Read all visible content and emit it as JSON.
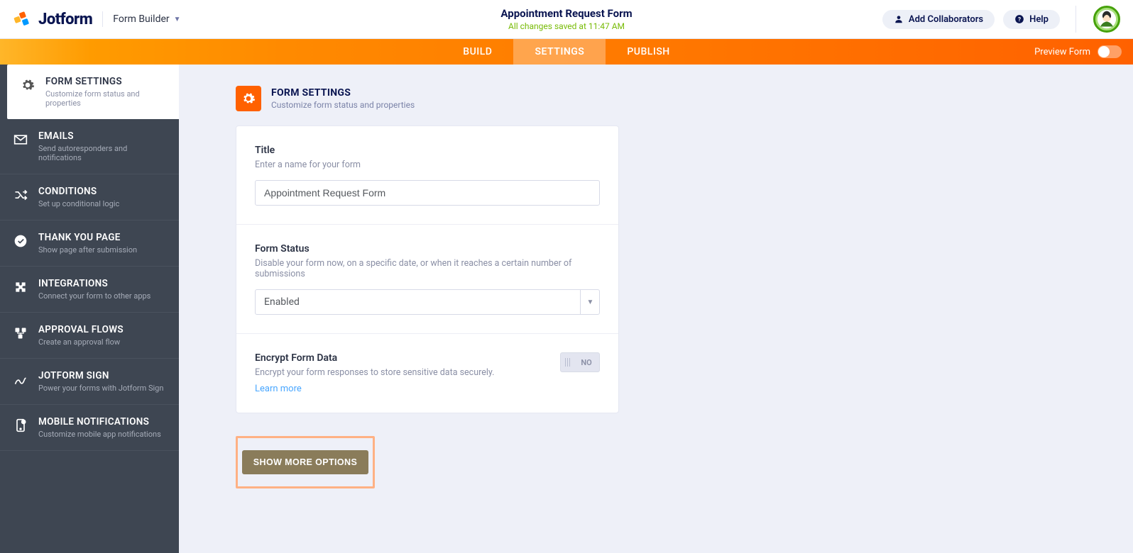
{
  "header": {
    "brand": "Jotform",
    "form_builder": "Form Builder",
    "form_title": "Appointment Request Form",
    "saved_text": "All changes saved at 11:47 AM",
    "add_collab": "Add Collaborators",
    "help": "Help"
  },
  "nav": {
    "tabs": [
      {
        "label": "BUILD",
        "active": false
      },
      {
        "label": "SETTINGS",
        "active": true
      },
      {
        "label": "PUBLISH",
        "active": false
      }
    ],
    "preview_label": "Preview Form"
  },
  "sidebar": [
    {
      "title": "FORM SETTINGS",
      "desc": "Customize form status and properties",
      "icon": "gear",
      "active": true
    },
    {
      "title": "EMAILS",
      "desc": "Send autoresponders and notifications",
      "icon": "mail",
      "active": false
    },
    {
      "title": "CONDITIONS",
      "desc": "Set up conditional logic",
      "icon": "shuffle",
      "active": false
    },
    {
      "title": "THANK YOU PAGE",
      "desc": "Show page after submission",
      "icon": "check",
      "active": false
    },
    {
      "title": "INTEGRATIONS",
      "desc": "Connect your form to other apps",
      "icon": "puzzle",
      "active": false
    },
    {
      "title": "APPROVAL FLOWS",
      "desc": "Create an approval flow",
      "icon": "flow",
      "active": false
    },
    {
      "title": "JOTFORM SIGN",
      "desc": "Power your forms with Jotform Sign",
      "icon": "sign",
      "active": false
    },
    {
      "title": "MOBILE NOTIFICATIONS",
      "desc": "Customize mobile app notifications",
      "icon": "mobile",
      "active": false
    }
  ],
  "section": {
    "title": "FORM SETTINGS",
    "desc": "Customize form status and properties"
  },
  "form": {
    "title_label": "Title",
    "title_sub": "Enter a name for your form",
    "title_value": "Appointment Request Form",
    "status_label": "Form Status",
    "status_sub": "Disable your form now, on a specific date, or when it reaches a certain number of submissions",
    "status_value": "Enabled",
    "encrypt_label": "Encrypt Form Data",
    "encrypt_sub": "Encrypt your form responses to store sensitive data securely.",
    "learn_more": "Learn more",
    "encrypt_toggle": "NO",
    "show_more": "SHOW MORE OPTIONS"
  }
}
